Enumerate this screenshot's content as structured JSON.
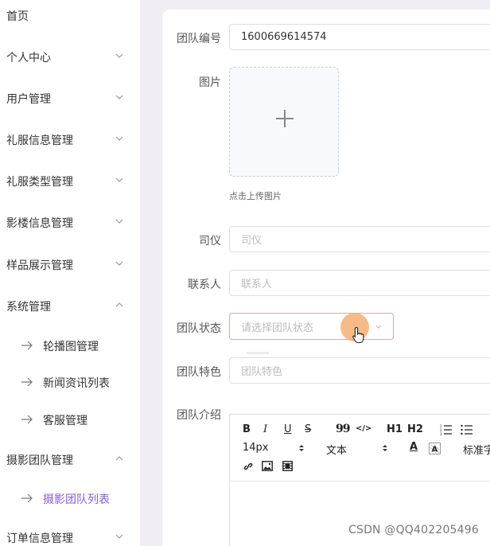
{
  "sidebar": {
    "items": [
      {
        "label": "首页"
      },
      {
        "label": "个人中心"
      },
      {
        "label": "用户管理"
      },
      {
        "label": "礼服信息管理"
      },
      {
        "label": "礼服类型管理"
      },
      {
        "label": "影楼信息管理"
      },
      {
        "label": "样品展示管理"
      },
      {
        "label": "系统管理"
      },
      {
        "label": "摄影团队管理"
      },
      {
        "label": "订单信息管理"
      }
    ],
    "system_sub": [
      "轮播图管理",
      "新闻资讯列表",
      "客服管理"
    ],
    "team_sub": [
      "摄影团队列表"
    ],
    "active_color": "#8a5cd1"
  },
  "form": {
    "team_no": {
      "label": "团队编号",
      "value": "1600669614574"
    },
    "image": {
      "label": "图片",
      "tip": "点击上传图片"
    },
    "host": {
      "label": "司仪",
      "placeholder": "司仪"
    },
    "contact": {
      "label": "联系人",
      "placeholder": "联系人"
    },
    "status": {
      "label": "团队状态",
      "placeholder": "请选择团队状态"
    },
    "feature": {
      "label": "团队特色",
      "placeholder": "团队特色"
    },
    "intro": {
      "label": "团队介绍"
    }
  },
  "editor": {
    "bold": "B",
    "italic": "I",
    "underline": "U",
    "strike": "S",
    "quote": "99",
    "code": "</>",
    "h1": "H1",
    "h2": "H2",
    "font_size": "14px",
    "text_style": "文本",
    "text_color": "A",
    "font_family": "标准字"
  },
  "watermark": "CSDN @QQ402205496"
}
